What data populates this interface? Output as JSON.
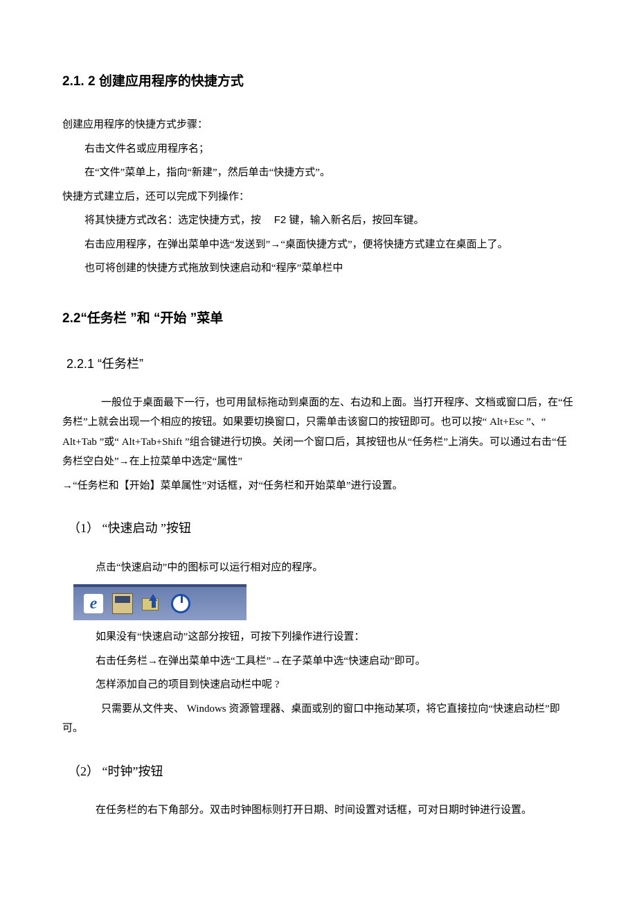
{
  "h_212": "2.1. 2 创建应用程序的快捷方式",
  "p1": "创建应用程序的快捷方式步骤：",
  "p2": "右击文件名或应用程序名；",
  "p3": "在“文件”菜单上，指向“新建”，然后单击“快捷方式”。",
  "p4": "快捷方式建立后，还可以完成下列操作：",
  "p5_a": "将其快捷方式改名：选定快捷方式，按",
  "p5_b": "F2 键，输入新名后，按回车键。",
  "p6": "右击应用程序，在弹出菜单中选“发送到”→“桌面快捷方式”，便将快捷方式建立在桌面上了。",
  "p7": "也可将创建的快捷方式拖放到快速启动和“程序”菜单栏中",
  "h_22": "2.2“任务栏 ”和 “开始 ”菜单",
  "h_221": "2.2.1 “任务栏”",
  "p8": "一般位于桌面最下一行，也可用鼠标拖动到桌面的左、右边和上面。当打开程序、文档或窗口后，在“任务栏”上就会出现一个相应的按钮。如果要切换窗口，只需单击该窗口的按钮即可。也可以按“ Alt+Esc ”、“ Alt+Tab ”或“ Alt+Tab+Shift ”组合键进行切换。关闭一个窗口后，其按钮也从“任务栏”上消失。可以通过右击“任务栏空白处”→在上拉菜单中选定“属性”",
  "p8b": "→“任务栏和【开始】菜单属性”对话框，对“任务栏和开始菜单”进行设置。",
  "h_sub1": "（1） “快速启动 ”按钮",
  "p9": "点击“快速启动”中的图标可以运行相对应的程序。",
  "p10": "如果没有“快速启动”这部分按钮，可按下列操作进行设置：",
  "p11": "右击任务栏→在弹出菜单中选“工具栏”→在子菜单中选“快速启动”即可。",
  "p12": "怎样添加自己的项目到快速启动栏中呢 ?",
  "p13": "只需要从文件夹、 Windows 资源管理器、桌面或别的窗口中拖动某项，将它直接拉向“快速启动栏”即可。",
  "h_sub2": "（2） “时钟”按钮",
  "p14": "在任务栏的右下角部分。双击时钟图标则打开日期、时间设置对话框，可对日期时钟进行设置。",
  "icons": {
    "ie": "internet-explorer-icon",
    "desktop": "show-desktop-icon",
    "outlook": "outlook-express-icon",
    "power": "power-icon"
  }
}
